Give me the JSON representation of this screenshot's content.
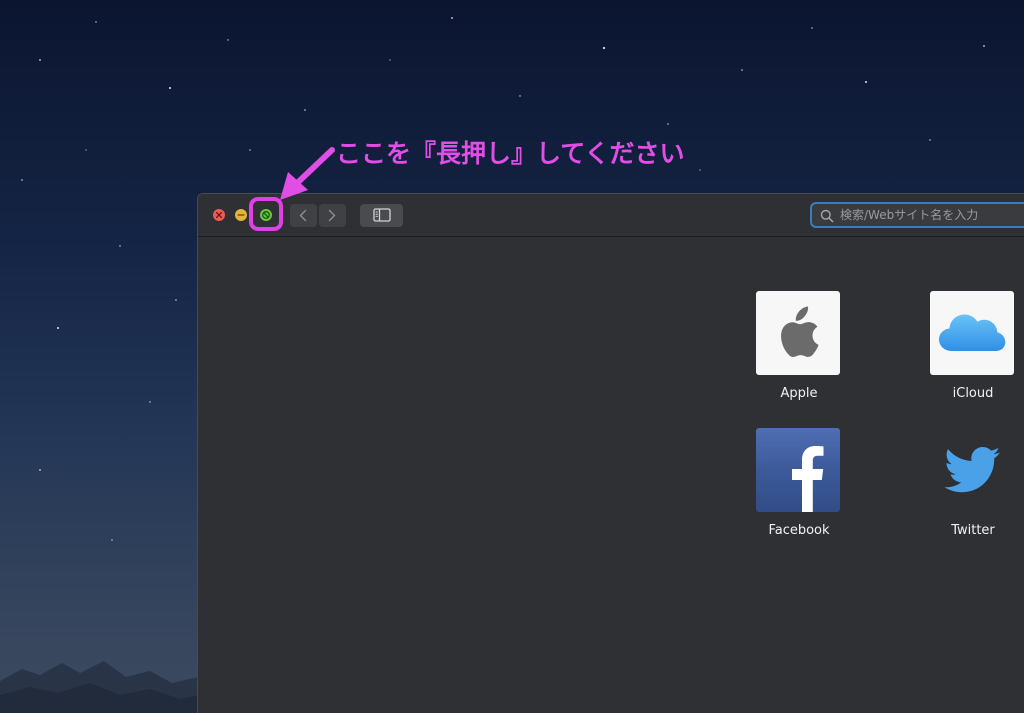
{
  "annotation": {
    "text": "ここを『長押し』してください",
    "color": "#e04ee6"
  },
  "window": {
    "traffic_lights": {
      "close": "close-icon",
      "minimize": "minimize-icon",
      "fullscreen": "fullscreen-icon"
    },
    "nav": {
      "back": "chevron-left-icon",
      "forward": "chevron-right-icon",
      "sidebar": "sidebar-icon"
    },
    "search": {
      "placeholder": "検索/Webサイト名を入力",
      "value": ""
    },
    "favorites": [
      {
        "label": "Apple",
        "icon": "apple-logo-icon"
      },
      {
        "label": "iCloud",
        "icon": "icloud-logo-icon"
      },
      {
        "label": "Facebook",
        "icon": "facebook-logo-icon"
      },
      {
        "label": "Twitter",
        "icon": "twitter-logo-icon"
      }
    ]
  },
  "colors": {
    "accent": "#3b7bbf",
    "close": "#ee5b54",
    "minimize": "#e3b33a",
    "fullscreen": "#6cc644",
    "facebook": "#3b5998",
    "twitter": "#4aa1e8"
  }
}
